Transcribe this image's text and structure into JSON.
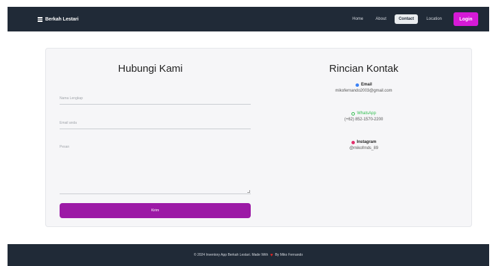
{
  "navbar": {
    "brand": "Berkah Lestari",
    "links": [
      "Home",
      "About",
      "Contact",
      "Location"
    ],
    "login": "Login"
  },
  "form": {
    "title": "Hubungi Kami",
    "name_placeholder": "Nama Lengkap",
    "email_placeholder": "Email anda",
    "message_placeholder": "Pesan",
    "submit": "Kirim"
  },
  "contact": {
    "title": "Rincian Kontak",
    "email_label": "Email",
    "email_value": "mikofernando2003@gmail.com",
    "whatsapp_label": "WhatsApp",
    "whatsapp_value": "(+62) 852-1570-2200",
    "instagram_label": "Instagram",
    "instagram_value": "@mikofrnds_89"
  },
  "footer": {
    "text_before": "© 2024 Inventory App Berkah Lestari. Made With",
    "text_after": "By Miko Fernando"
  },
  "colors": {
    "navbar": "#202a37",
    "login": "#d61ad6",
    "submit": "#9c1aa6",
    "email_dot": "#3b82f6",
    "instagram_dot": "#e1306c",
    "whatsapp": "#2fbe4e"
  }
}
